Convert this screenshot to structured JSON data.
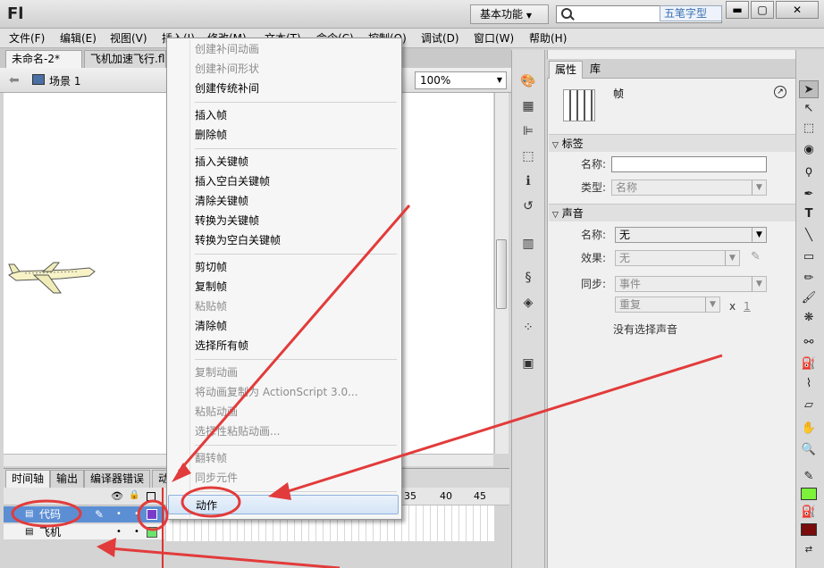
{
  "app": {
    "logo": "Fl",
    "workspace": "基本功能",
    "ime_label": "五笔字型",
    "window_min": "▬",
    "window_max": "▢",
    "window_close": "✕"
  },
  "menu": [
    "文件(F)",
    "编辑(E)",
    "视图(V)",
    "插入(I)",
    "修改(M)",
    "文本(T)",
    "命令(C)",
    "控制(O)",
    "调试(D)",
    "窗口(W)",
    "帮助(H)"
  ],
  "tabs": {
    "doc1": "未命名-2*",
    "doc2": "飞机加速飞行.fl"
  },
  "scene": {
    "label": "场景 1",
    "zoom": "100%"
  },
  "timeline": {
    "tabs": [
      "时间轴",
      "输出",
      "编译器错误",
      "动"
    ],
    "frame_numbers": [
      "35",
      "40",
      "45"
    ],
    "layers": [
      {
        "name": "代码"
      },
      {
        "name": "飞机"
      }
    ]
  },
  "context_menu": {
    "items": [
      {
        "label": "创建补间动画",
        "disabled": true
      },
      {
        "label": "创建补间形状",
        "disabled": true
      },
      {
        "label": "创建传统补间",
        "disabled": false
      },
      {
        "label": "插入帧",
        "disabled": false
      },
      {
        "label": "删除帧",
        "disabled": false
      },
      {
        "label": "插入关键帧",
        "disabled": false
      },
      {
        "label": "插入空白关键帧",
        "disabled": false
      },
      {
        "label": "清除关键帧",
        "disabled": false
      },
      {
        "label": "转换为关键帧",
        "disabled": false
      },
      {
        "label": "转换为空白关键帧",
        "disabled": false
      },
      {
        "label": "剪切帧",
        "disabled": false
      },
      {
        "label": "复制帧",
        "disabled": false
      },
      {
        "label": "粘贴帧",
        "disabled": true
      },
      {
        "label": "清除帧",
        "disabled": false
      },
      {
        "label": "选择所有帧",
        "disabled": false
      },
      {
        "label": "复制动画",
        "disabled": true
      },
      {
        "label": "将动画复制为 ActionScript 3.0...",
        "disabled": true
      },
      {
        "label": "粘贴动画",
        "disabled": true
      },
      {
        "label": "选择性粘贴动画...",
        "disabled": true
      },
      {
        "label": "翻转帧",
        "disabled": true
      },
      {
        "label": "同步元件",
        "disabled": true
      },
      {
        "label": "动作",
        "disabled": false
      }
    ]
  },
  "properties": {
    "tabs": [
      "属性",
      "库"
    ],
    "title": "帧",
    "section_label": "标签",
    "name_label": "名称:",
    "type_label": "类型:",
    "type_value": "名称",
    "section_sound": "声音",
    "sound_name_label": "名称:",
    "sound_name_value": "无",
    "effect_label": "效果:",
    "effect_value": "无",
    "sync_label": "同步:",
    "sync_value": "事件",
    "repeat_value": "重复",
    "x_label": "x",
    "repeat_count": "1",
    "no_sound": "没有选择声音"
  },
  "colors": {
    "accent": "#5c8ed4",
    "annotation": "#e23b3b",
    "stroke_swatch": "#7cf23a",
    "fill_swatch": "#7a0c0c"
  }
}
